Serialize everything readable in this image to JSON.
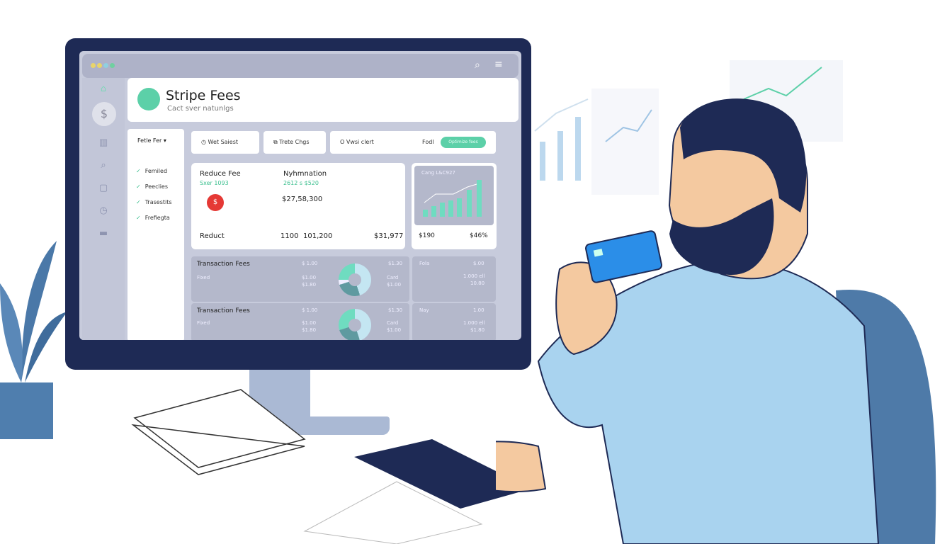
{
  "app": {
    "title": "Stripe Fees",
    "subtitle": "Cact sver natunlgs"
  },
  "sidebar": {
    "icons": [
      "home-icon",
      "dollar-icon",
      "bar-chart-icon",
      "search-icon",
      "lock-icon",
      "clock-icon",
      "card-icon"
    ]
  },
  "filter": {
    "label": "Fetle Fer",
    "items": [
      "Femiled",
      "Peeclies",
      "Trasestits",
      "Frefiegta"
    ]
  },
  "tabs": [
    {
      "label": "Wet Saiest",
      "icon": "clock-icon"
    },
    {
      "label": "Trete Chgs",
      "icon": "copy-icon"
    },
    {
      "label": "Vwsi clert",
      "icon": "circle-icon"
    }
  ],
  "toolbar": {
    "label": "Fodl",
    "button": "Optimize fees"
  },
  "summary": {
    "col1_title": "Reduce Fee",
    "col1_sub": "Sxer 1093",
    "col2_title": "Nyhmnation",
    "col2_sub": "2612 s $520",
    "amount": "$27,58,300",
    "row_label": "Reduct",
    "row_v1": "1100",
    "row_v2": "101,200",
    "row_v3": "$31,977"
  },
  "chart_card": {
    "title": "Cang L&C927",
    "foot_left": "$190",
    "foot_right": "$46%"
  },
  "fees": [
    {
      "title": "Transaction Fees",
      "a": "$ 1.00",
      "b": "$1.00",
      "c": "$1.80",
      "d": "$1.30",
      "e": "Card",
      "f": "$1.00",
      "label": "Fixed"
    },
    {
      "title": "Transaction Fees",
      "a": "$ 1.00",
      "b": "$1.00",
      "c": "$1.80",
      "d": "$1.30",
      "e": "Card",
      "f": "$1.00",
      "label": "Fixed"
    }
  ],
  "side_cards": [
    {
      "label": "Fola",
      "v1": "$.00",
      "v2": "1.000 ell",
      "v3": "10.80"
    },
    {
      "label": "Nay",
      "v1": "1.00",
      "v2": "1.000 ell",
      "v3": "$1.80"
    }
  ],
  "colors": {
    "accent": "#5cd0a8",
    "monitor": "#1e2a55",
    "shirt": "#a9d3ef",
    "card": "#2b8ee8"
  }
}
